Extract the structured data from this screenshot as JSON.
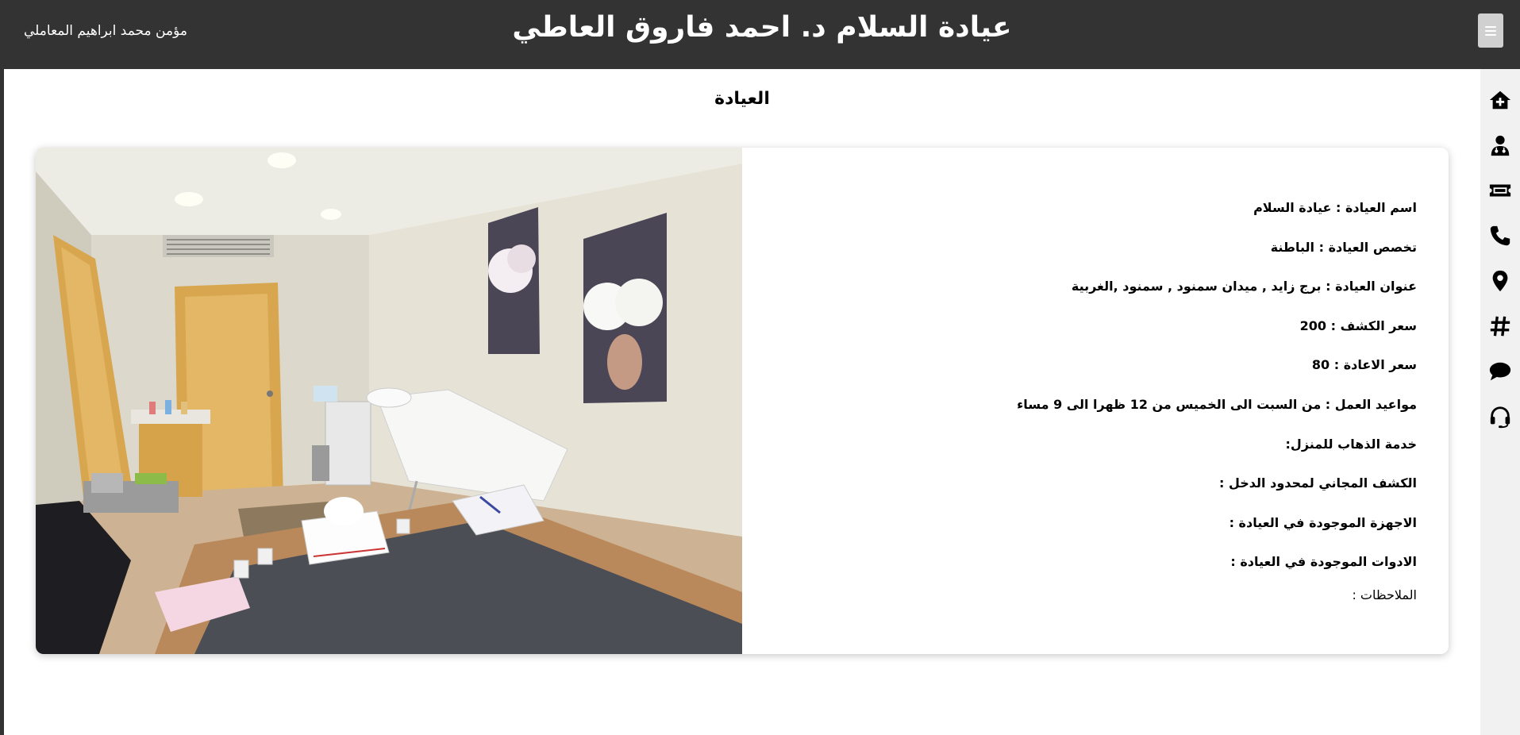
{
  "header": {
    "title": "عيادة السلام د. احمد فاروق العاطي",
    "user_name": "مؤمن محمد ابراهيم المعاملي"
  },
  "page": {
    "heading": "العيادة"
  },
  "sidebar": {
    "items": [
      {
        "icon": "home-plus-icon"
      },
      {
        "icon": "doctor-icon"
      },
      {
        "icon": "ticket-icon"
      },
      {
        "icon": "phone-icon"
      },
      {
        "icon": "location-icon"
      },
      {
        "icon": "hashtag-icon"
      },
      {
        "icon": "chat-icon"
      },
      {
        "icon": "headset-icon"
      }
    ]
  },
  "clinic": {
    "name_label": "اسم العيادة : ",
    "name_value": "عيادة السلام",
    "specialty_label": "تخصص العيادة : ",
    "specialty_value": "الباطنة",
    "address_label": "عنوان العيادة : ",
    "address_value": "برج زايد , ميدان سمنود , سمنود ,الغربية",
    "exam_price_label": "سعر الكشف : ",
    "exam_price_value": "200",
    "revisit_price_label": "سعر الاعادة : ",
    "revisit_price_value": "80",
    "hours_label": "مواعيد العمل : ",
    "hours_value": "من السبت الى الخميس من 12 ظهرا الى 9 مساء",
    "home_service_label": "خدمة الذهاب للمنزل:",
    "free_exam_label": "الكشف المجاني لمحدود الدخل :",
    "devices_label": "الاجهزة الموجودة في العيادة :",
    "tools_label": "الادوات الموجودة في العيادة :",
    "notes_label": "الملاحظات :"
  },
  "colors": {
    "topbar": "#333333",
    "sidebar": "#f1f1f1",
    "menu_button": "#d0d0d0"
  }
}
